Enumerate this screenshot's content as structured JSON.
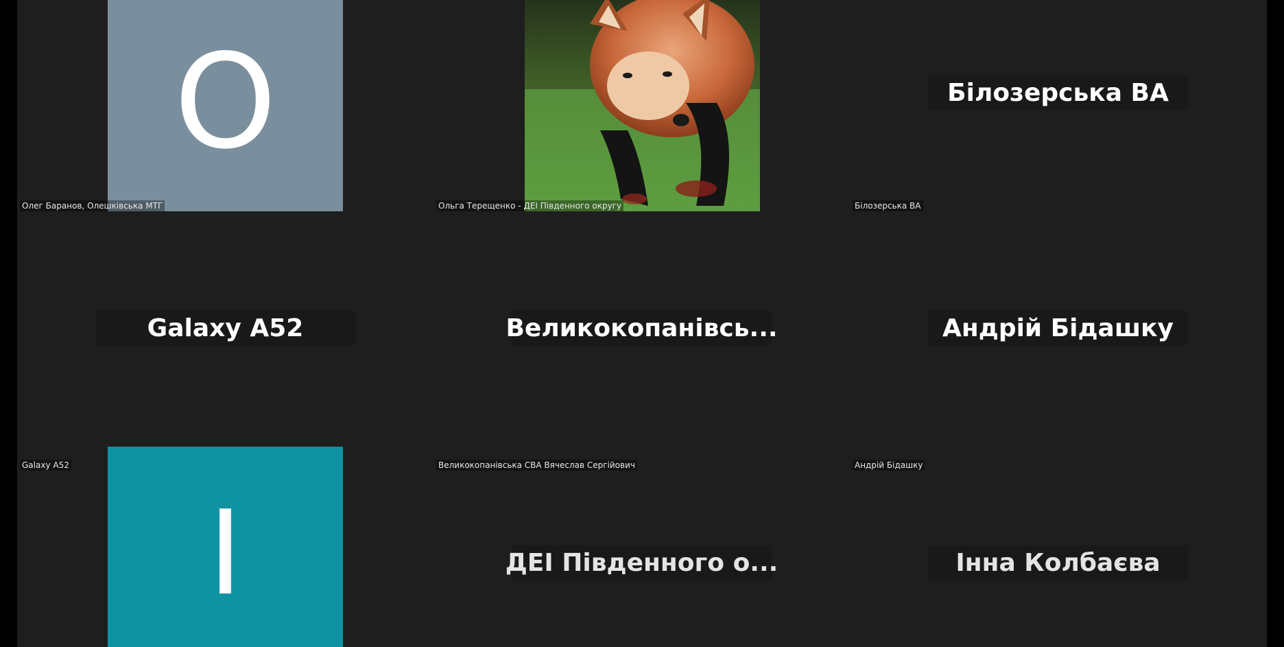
{
  "meeting": {
    "tiles": [
      {
        "label": "Олег Баранов, Олешківська МТГ",
        "avatar_initial": "О",
        "avatar_color": "#7a8f9e"
      },
      {
        "label": "Ольга Терещенко - ДЕІ Південного округу",
        "avatar_image": "fox-photo"
      },
      {
        "label": "Білозерська ВА",
        "name_card": "Білозерська ВА"
      },
      {
        "label": "Galaxy A52",
        "name_card": "Galaxy A52"
      },
      {
        "label": "Великокопанівська СВА Вячеслав Сергійович",
        "name_card": "Великокопанівсь..."
      },
      {
        "label": "Андрій Бідашку",
        "name_card": "Андрій Бідашку"
      },
      {
        "avatar_initial": "І",
        "avatar_color": "#0f93a3"
      },
      {
        "name_card": "ДЕІ Південного  о..."
      },
      {
        "name_card": "Інна Колбаєва"
      }
    ]
  }
}
